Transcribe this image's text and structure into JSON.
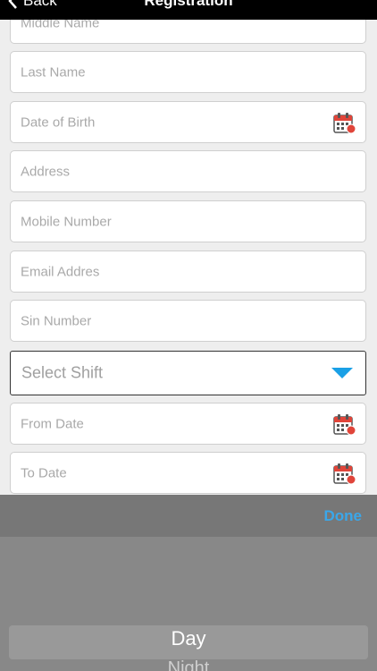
{
  "nav": {
    "back_label": "Back",
    "title": "Registration"
  },
  "form": {
    "fields": [
      {
        "placeholder": "Middle Name"
      },
      {
        "placeholder": "Last Name"
      },
      {
        "placeholder": "Date of Birth",
        "icon": "calendar-icon"
      },
      {
        "placeholder": "Address"
      },
      {
        "placeholder": "Mobile Number"
      },
      {
        "placeholder": "Email Addres"
      },
      {
        "placeholder": "Sin Number"
      },
      {
        "placeholder": "Select Shift",
        "icon": "dropdown-caret-icon"
      },
      {
        "placeholder": "From Date",
        "icon": "calendar-icon"
      },
      {
        "placeholder": "To Date",
        "icon": "calendar-icon"
      }
    ]
  },
  "picker": {
    "done_label": "Done",
    "options": [
      "Day",
      "Night"
    ],
    "selected": "Day"
  },
  "colors": {
    "accent": "#3aa7ea",
    "dropdown_caret": "#1aa0e6",
    "calendar_red": "#e0453a"
  }
}
